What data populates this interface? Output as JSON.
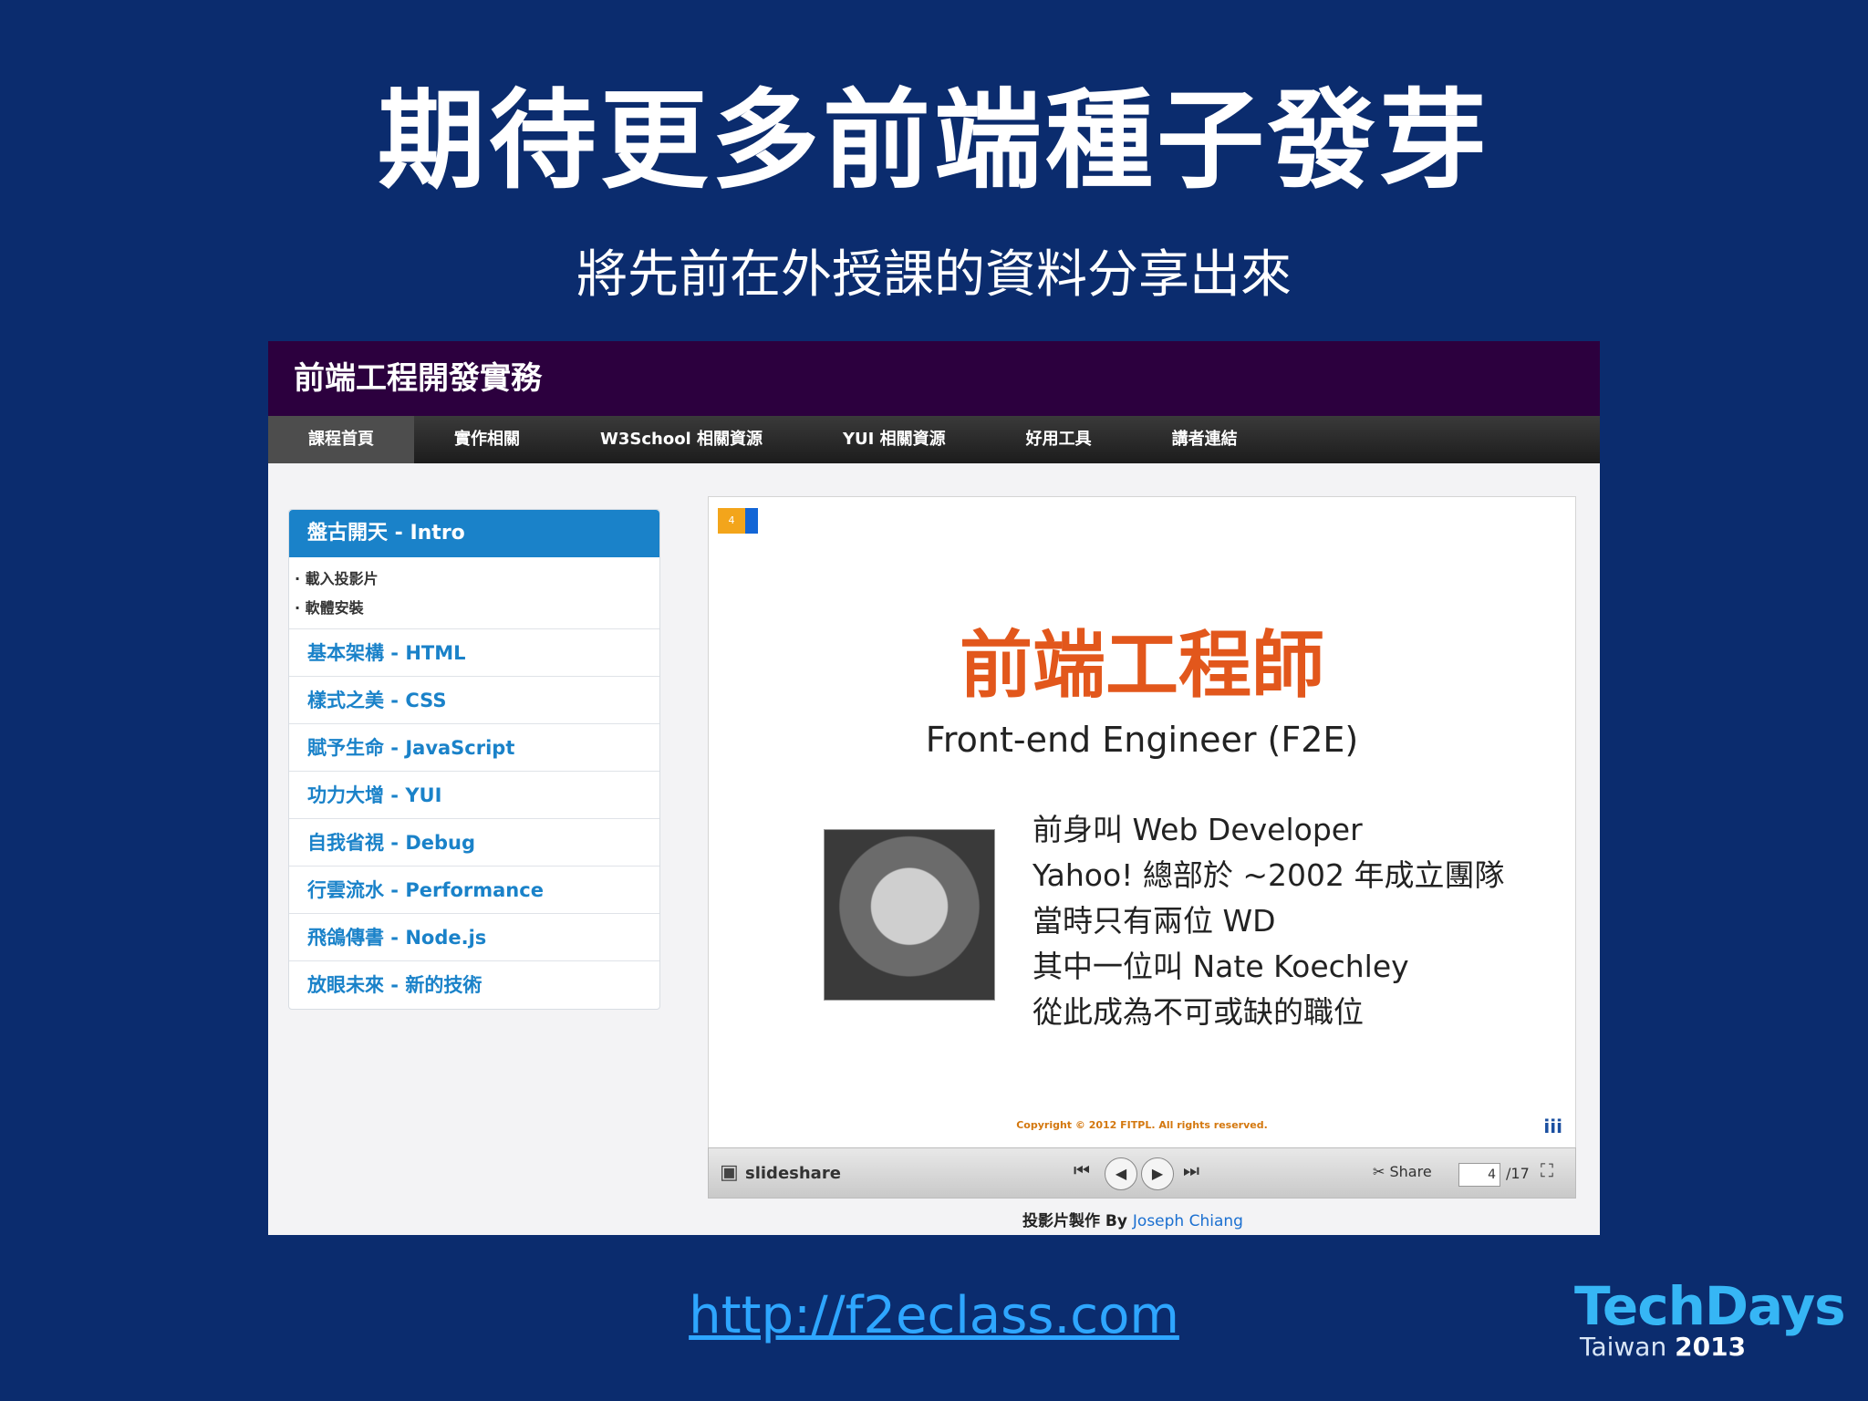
{
  "slide": {
    "title": "期待更多前端種子發芽",
    "subtitle": "將先前在外授課的資料分享出來",
    "url": "http://f2eclass.com"
  },
  "brand": {
    "name": "TechDays",
    "region": "Taiwan",
    "year": "2013"
  },
  "site": {
    "header": "前端工程開發實務",
    "nav": [
      "課程首頁",
      "實作相關",
      "W3School 相關資源",
      "YUI 相關資源",
      "好用工具",
      "講者連結"
    ],
    "sidebar": {
      "active": "盤古開天 - Intro",
      "sub_items": [
        "載入投影片",
        "軟體安裝"
      ],
      "items": [
        "基本架構 - HTML",
        "樣式之美 - CSS",
        "賦予生命 - JavaScript",
        "功力大增 - YUI",
        "自我省視 - Debug",
        "行雲流水 - Performance",
        "飛鴿傳書 - Node.js",
        "放眼未來 - 新的技術"
      ]
    },
    "embedded_slide": {
      "badge": "4",
      "title": "前端工程師",
      "subtitle": "Front-end Engineer (F2E)",
      "lines": [
        "前身叫 Web Developer",
        "Yahoo! 總部於 ~2002 年成立團隊",
        "當時只有兩位 WD",
        "其中一位叫 Nate Koechley",
        "從此成為不可或缺的職位"
      ],
      "copyright": "Copyright © 2012 FITPL. All rights reserved.",
      "logo": "iii"
    },
    "player": {
      "brand": "slideshare",
      "share_label": "Share",
      "page_current": "4",
      "page_total": "/17"
    },
    "credit": {
      "prefix": "投影片製作 By",
      "author": "Joseph Chiang"
    }
  }
}
